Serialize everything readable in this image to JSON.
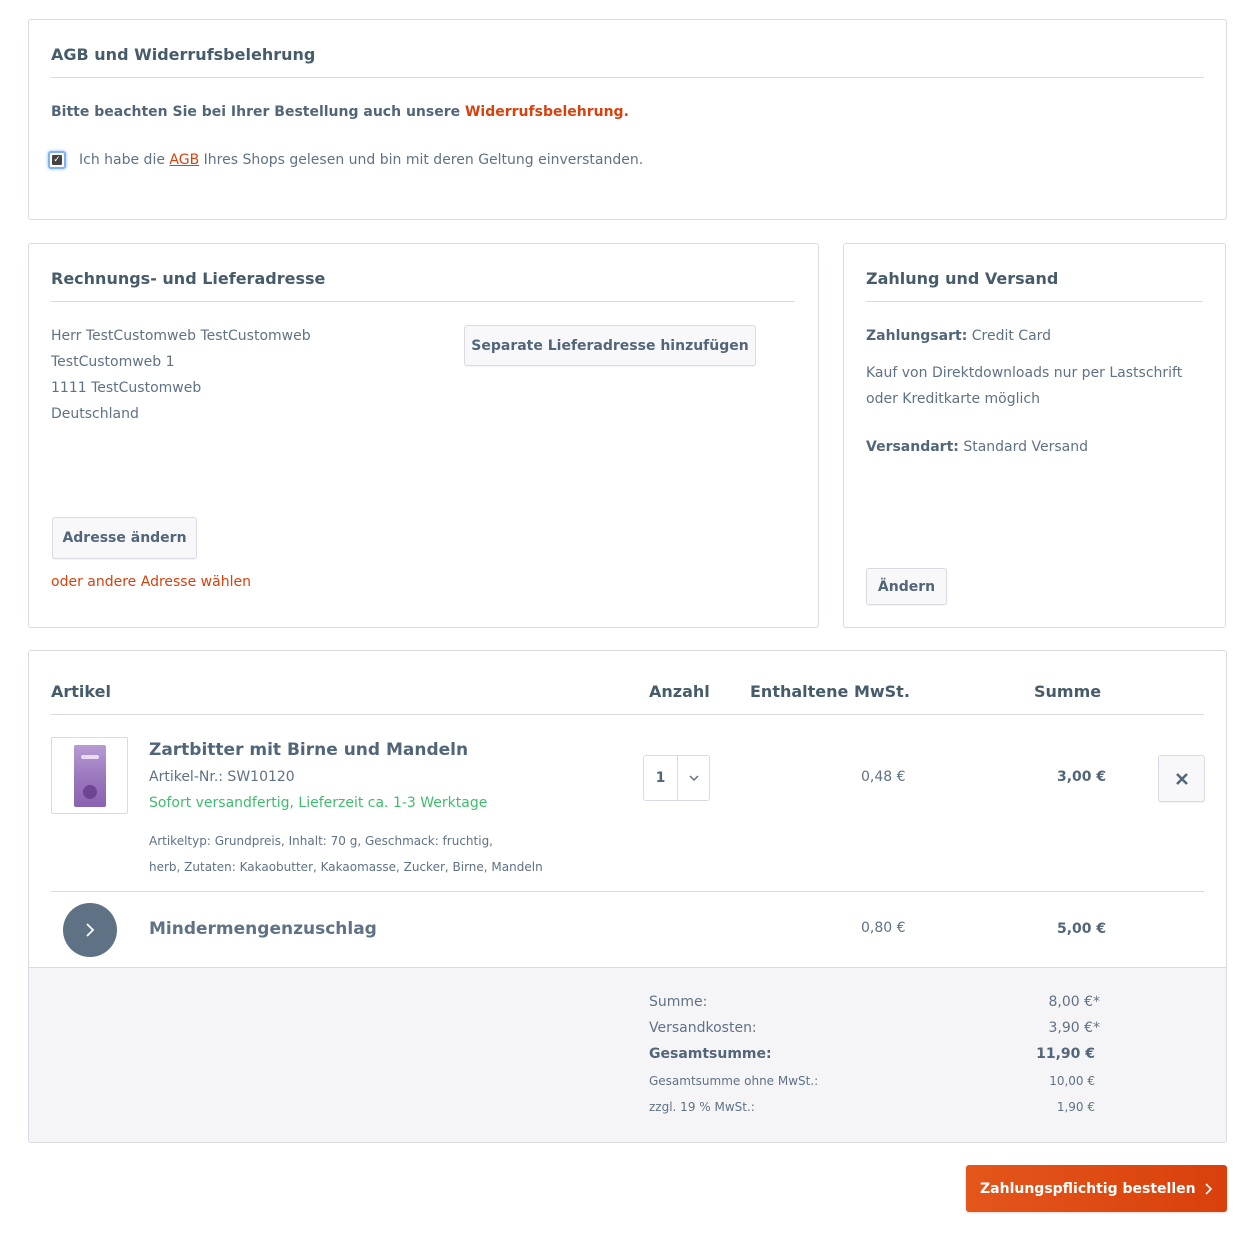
{
  "agb": {
    "title": "AGB und Widerrufsbelehrung",
    "notice_prefix": "Bitte beachten Sie bei Ihrer Bestellung auch unsere",
    "notice_link": "Widerrufsbelehrung",
    "notice_suffix": ".",
    "checkbox_checked": true,
    "checkbox_prefix": "Ich habe die",
    "checkbox_link": "AGB",
    "checkbox_suffix": "Ihres Shops gelesen und bin mit deren Geltung einverstanden."
  },
  "address": {
    "title": "Rechnungs- und Lieferadresse",
    "lines": [
      "Herr TestCustomweb TestCustomweb",
      "TestCustomweb 1",
      "1111 TestCustomweb",
      "Deutschland"
    ],
    "add_shipping_button": "Separate Lieferadresse hinzufügen",
    "change_button": "Adresse ändern",
    "other_address_link": "oder andere Adresse wählen"
  },
  "payment": {
    "title": "Zahlung und Versand",
    "payment_label": "Zahlungsart:",
    "payment_value": "Credit Card",
    "note_line1": "Kauf von Direktdownloads nur per Lastschrift",
    "note_line2": "oder Kreditkarte möglich",
    "shipping_label": "Versandart:",
    "shipping_value": "Standard Versand",
    "change_button": "Ändern"
  },
  "cart": {
    "headers": {
      "article": "Artikel",
      "quantity": "Anzahl",
      "vat": "Enthaltene MwSt.",
      "total": "Summe"
    },
    "item": {
      "name": "Zartbitter mit Birne und Mandeln",
      "sku": "Artikel-Nr.: SW10120",
      "delivery": "Sofort versandfertig, Lieferzeit ca. 1-3 Werktage",
      "desc_line1": "Artikeltyp: Grundpreis, Inhalt: 70 g, Geschmack: fruchtig,",
      "desc_line2": "herb, Zutaten: Kakaobutter, Kakaomasse, Zucker, Birne, Mandeln",
      "quantity": "1",
      "vat": "0,48 €",
      "total": "3,00 €"
    },
    "surcharge": {
      "name": "Mindermengenzuschlag",
      "vat": "0,80 €",
      "total": "5,00 €"
    },
    "summary": {
      "sum_label": "Summe:",
      "sum_value": "8,00 €*",
      "shipping_label": "Versandkosten:",
      "shipping_value": "3,90 €*",
      "grand_label": "Gesamtsumme:",
      "grand_value": "11,90 €",
      "net_label": "Gesamtsumme ohne MwSt.:",
      "net_value": "10,00 €",
      "tax_label": "zzgl. 19 % MwSt.:",
      "tax_value": "1,90 €"
    }
  },
  "order_button": "Zahlungspflichtig bestellen",
  "colors": {
    "accent": "#d9400b",
    "green": "#3ebc6d",
    "border": "#dadae5",
    "text": "#5f7285"
  }
}
